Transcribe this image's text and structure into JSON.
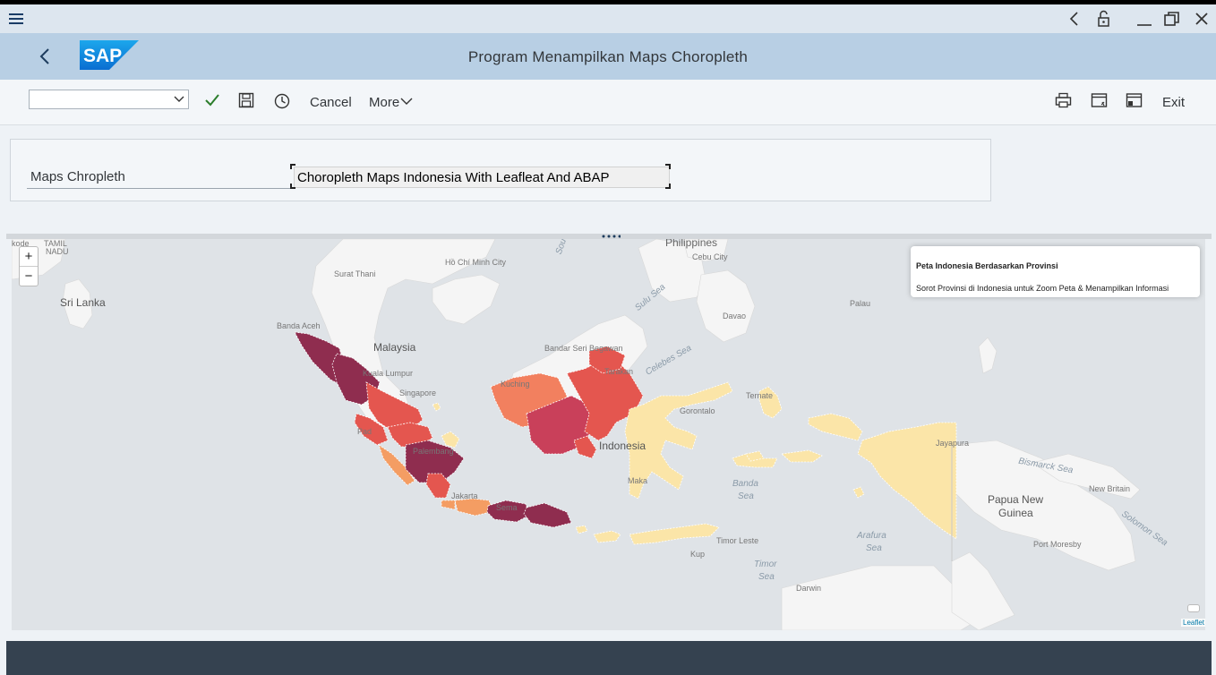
{
  "title": "Program Menampilkan Maps Choropleth",
  "toolbar": {
    "cancel": "Cancel",
    "more": "More",
    "exit": "Exit"
  },
  "form": {
    "label": "Maps Chropleth",
    "value": "Choropleth Maps Indonesia With Leafleat And ABAP"
  },
  "map": {
    "info_title": "Peta Indonesia Berdasarkan Provinsi",
    "info_text": "Sorot Provinsi di Indonesia untuk Zoom Peta & Menampilkan Informasi",
    "zoom_in": "+",
    "zoom_out": "−",
    "attribution": "Leaflet",
    "labels": {
      "philippines": "Philippines",
      "sri_lanka": "Sri Lanka",
      "malaysia": "Malaysia",
      "papua": "Papua New",
      "guinea": "Guinea",
      "indonesia": "Indonesia",
      "tamil": "TAMIL",
      "nadu": "NADU",
      "hochiminh": "Hồ Chí Minh City",
      "suratthani": "Surat Thani",
      "bandaaceh": "Banda Aceh",
      "kualalumpur": "Kuala Lumpur",
      "singapore": "Singapore",
      "kuching": "Kuching",
      "bandarseri": "Bandar Seri Begawan",
      "cebu": "Cebu City",
      "davao": "Davao",
      "palau": "Palau",
      "jayapura": "Jayapura",
      "newbritain": "New Britain",
      "portmoresby": "Port Moresby",
      "darwin": "Darwin",
      "timorleste": "Timor Leste",
      "kupang": "Kup",
      "jakarta": "Jakarta",
      "semarang": "Sema",
      "palembang": "Palembang",
      "tarakan": "Tarakan",
      "ternate": "Ternate",
      "gorontalo": "Gorontalo",
      "makassar": "Maka",
      "padang": "Pad",
      "kode": "ikode"
    },
    "seas": {
      "sulu": "Sulu Sea",
      "celebes": "Celebes Sea",
      "banda": "Banda",
      "banda2": "Sea",
      "bismarck": "Bismarck Sea",
      "arafura": "Arafura",
      "arafura2": "Sea",
      "timor": "Timor",
      "timor2": "Sea",
      "solomon": "Solomon Sea",
      "south": "Sou"
    }
  },
  "colors": {
    "dark": "#8f2d4f",
    "red": "#c9405a",
    "orange_red": "#e4564f",
    "salmon": "#f2805f",
    "orange": "#f49d63",
    "yellow": "#fbe5a8"
  }
}
